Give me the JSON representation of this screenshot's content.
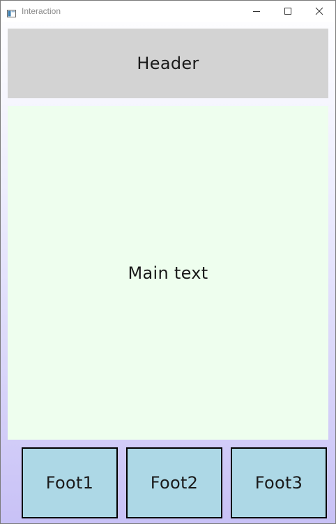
{
  "window": {
    "title": "Interaction",
    "controls": {
      "minimize_icon": "minimize-icon",
      "maximize_icon": "maximize-icon",
      "close_icon": "close-icon"
    }
  },
  "header": {
    "text": "Header"
  },
  "main": {
    "text": "Main text"
  },
  "footer": {
    "items": [
      {
        "label": "Foot1"
      },
      {
        "label": "Foot2"
      },
      {
        "label": "Foot3"
      }
    ]
  },
  "colors": {
    "header_bg": "#d3d3d3",
    "main_bg": "#eefeee",
    "foot_bg": "#add8e6",
    "window_gradient_bottom": "#c8c1f6"
  }
}
